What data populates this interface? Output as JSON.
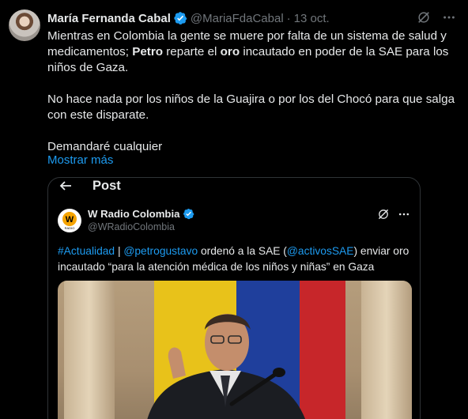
{
  "tweet": {
    "author_name": "María Fernanda Cabal",
    "handle": "@MariaFdaCabal",
    "separator": "·",
    "date": "13 oct.",
    "text_line1_a": "Mientras en Colombia la gente se muere por falta de un sistema de salud y medicamentos; ",
    "text_bold1": "Petro",
    "text_line1_b": " reparte el ",
    "text_bold2": "oro",
    "text_line1_c": " incautado en poder de la SAE para los niños de Gaza.",
    "text_para2": "No hace nada por los niños de la Guajira o por los del Chocó para que salga con este disparate.",
    "text_para3": "Demandaré cualquier",
    "show_more": "Mostrar más"
  },
  "quote": {
    "title": "Post",
    "author_name": "W Radio Colombia",
    "handle": "@WRadioColombia",
    "avatar_text": "W",
    "avatar_sub": "RADIO",
    "hashtag": "#Actualidad",
    "sep": " | ",
    "mention1": "@petrogustavo",
    "text_a": " ordenó a la SAE (",
    "mention2": "@activosSAE",
    "text_b": ") enviar oro incautado “para la atención médica de los niños y niñas” en Gaza"
  },
  "colors": {
    "background": "#000000",
    "accent": "#1d9bf0",
    "secondary_text": "#71767b",
    "primary_text": "#e7e9ea"
  },
  "icons": [
    "verified-badge-icon",
    "grok-icon",
    "more-icon",
    "back-arrow-icon"
  ]
}
